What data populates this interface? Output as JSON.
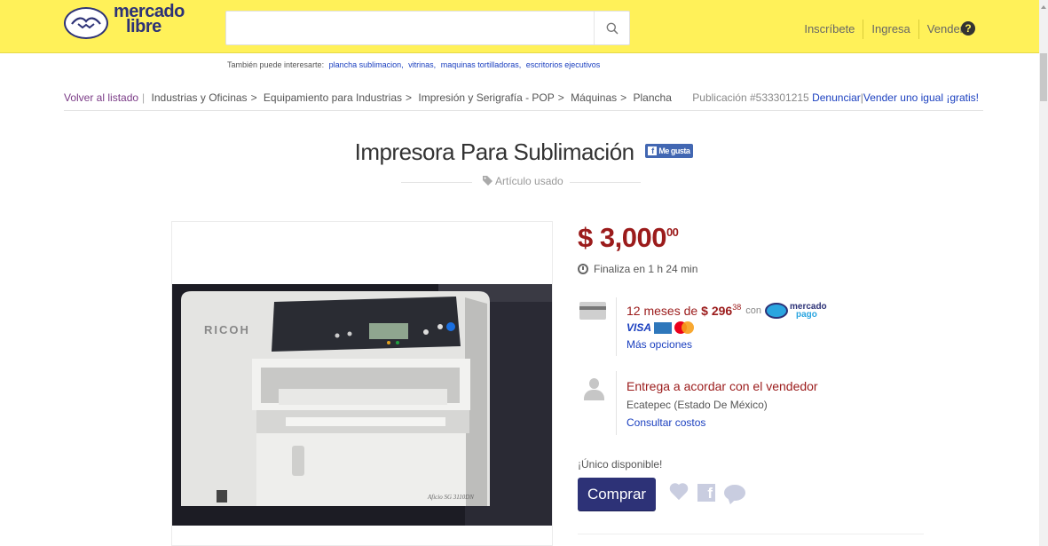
{
  "header": {
    "logo": {
      "line1": "mercado",
      "line2": "libre"
    },
    "search": {
      "value": "",
      "placeholder": ""
    },
    "links": [
      "Inscríbete",
      "Ingresa",
      "Vender"
    ],
    "help_icon": "question-circle-icon",
    "brand_color": "#fff159",
    "logo_color": "#2d3277"
  },
  "suggestions": {
    "prefix": "También puede interesarte:",
    "items": [
      "plancha sublimacion,",
      "vitrinas,",
      "maquinas tortilladoras,",
      "escritorios ejecutivos"
    ]
  },
  "breadcrumb": {
    "back": "Volver al listado",
    "items": [
      "Industrias y Oficinas",
      "Equipamiento para Industrias",
      "Impresión y Serigrafía - POP",
      "Máquinas",
      "Plancha"
    ],
    "separator": ">"
  },
  "publication": {
    "label": "Publicación #533301215",
    "report": "Denunciar",
    "sell_same": "Vender uno igual ¡gratis!"
  },
  "product": {
    "title": "Impresora Para Sublimación",
    "fb_like": "Me gusta",
    "condition": "Artículo usado",
    "photo_brand": "RICOH",
    "photo_model": "Aficio SG 3110DN"
  },
  "offer": {
    "price_main": "$ 3,000",
    "price_cents": "00",
    "price_color": "#9b1b1b",
    "ends": "Finaliza en 1 h 24 min",
    "installments_prefix": "12 meses de",
    "installment_amount": "$ 296",
    "installment_cents": "38",
    "with": "con",
    "mp_logo": {
      "line1": "mercado",
      "line2": "pago"
    },
    "card_brands": [
      "VISA",
      "American Express",
      "MasterCard"
    ],
    "more_options": "Más opciones",
    "delivery": "Entrega a acordar con el vendedor",
    "location": "Ecatepec (Estado De México)",
    "shipping_costs": "Consultar costos",
    "stock": "¡Único disponible!",
    "buy": "Comprar",
    "button_color": "#2d3277"
  }
}
